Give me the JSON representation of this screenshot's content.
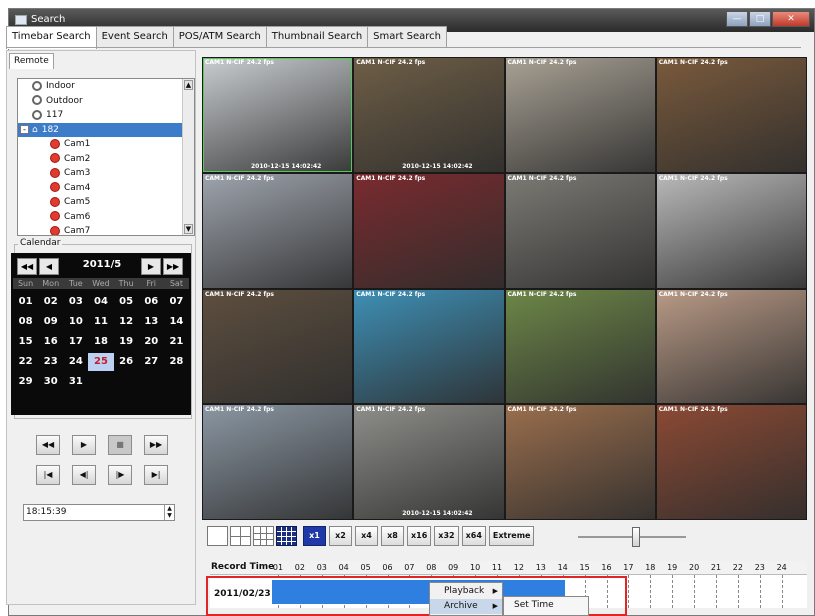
{
  "window": {
    "title": "Search",
    "btn_min": "—",
    "btn_max": "□",
    "btn_close": "✕"
  },
  "tabs": [
    "Timebar Search",
    "Event Search",
    "POS/ATM Search",
    "Thumbnail Search",
    "Smart Search"
  ],
  "remote_tab": "Remote",
  "tree": [
    {
      "label": "Indoor",
      "kind": "site"
    },
    {
      "label": "Outdoor",
      "kind": "site"
    },
    {
      "label": "117",
      "kind": "site"
    },
    {
      "label": "182",
      "kind": "home",
      "selected": true,
      "expander": "-"
    },
    {
      "label": "Cam1",
      "kind": "cam"
    },
    {
      "label": "Cam2",
      "kind": "cam"
    },
    {
      "label": "Cam3",
      "kind": "cam"
    },
    {
      "label": "Cam4",
      "kind": "cam"
    },
    {
      "label": "Cam5",
      "kind": "cam"
    },
    {
      "label": "Cam6",
      "kind": "cam"
    },
    {
      "label": "Cam7",
      "kind": "cam"
    }
  ],
  "calendar": {
    "label": "Calendar",
    "month": "2011/5",
    "weekdays": [
      "Sun",
      "Mon",
      "Tue",
      "Wed",
      "Thu",
      "Fri",
      "Sat"
    ],
    "days": [
      "01",
      "02",
      "03",
      "04",
      "05",
      "06",
      "07",
      "08",
      "09",
      "10",
      "11",
      "12",
      "13",
      "14",
      "15",
      "16",
      "17",
      "18",
      "19",
      "20",
      "21",
      "22",
      "23",
      "24",
      "25",
      "26",
      "27",
      "28",
      "29",
      "30",
      "31"
    ],
    "today": "25",
    "nav": {
      "prev_year": "◀◀",
      "prev_month": "◀",
      "next_month": "▶",
      "next_year": "▶▶"
    }
  },
  "playback_buttons": {
    "rewind": "◀◀",
    "play": "▶",
    "stop": "■",
    "fast_forward": "▶▶",
    "go_start": "|◀",
    "step_back": "◀|",
    "step_forward": "|▶",
    "go_end": "▶|"
  },
  "time_value": "18:15:39",
  "cameras": [
    {
      "label": "CAM1 N-CIF 24.2 fps",
      "timestamp": "2010-12-15  14:02:42",
      "color": "#c9cdd0"
    },
    {
      "label": "CAM1 N-CIF 24.2 fps",
      "timestamp": "2010-12-15  14:02:42",
      "color": "#6e5e46"
    },
    {
      "label": "CAM1 N-CIF 24.2 fps",
      "timestamp": "",
      "color": "#a8a194"
    },
    {
      "label": "CAM1 N-CIF 24.2 fps",
      "timestamp": "",
      "color": "#7a5a3c"
    },
    {
      "label": "CAM1 N-CIF 24.2 fps",
      "timestamp": "",
      "color": "#9ea4ad"
    },
    {
      "label": "CAM1 N-CIF 24.2 fps",
      "timestamp": "",
      "color": "#7a2b2e"
    },
    {
      "label": "CAM1 N-CIF 24.2 fps",
      "timestamp": "",
      "color": "#7c7a74"
    },
    {
      "label": "CAM1 N-CIF 24.2 fps",
      "timestamp": "",
      "color": "#b9b9b9"
    },
    {
      "label": "CAM1 N-CIF 24.2 fps",
      "timestamp": "",
      "color": "#5e4f3f"
    },
    {
      "label": "CAM1 N-CIF 24.2 fps",
      "timestamp": "",
      "color": "#3e8fb5"
    },
    {
      "label": "CAM1 N-CIF 24.2 fps",
      "timestamp": "",
      "color": "#6d8748"
    },
    {
      "label": "CAM1 N-CIF 24.2 fps",
      "timestamp": "",
      "color": "#b99a86"
    },
    {
      "label": "CAM1 N-CIF 24.2 fps",
      "timestamp": "",
      "color": "#8b97a3"
    },
    {
      "label": "CAM1 N-CIF 24.2 fps",
      "timestamp": "2010-12-15  14:02:42",
      "color": "#8e8f8a"
    },
    {
      "label": "CAM1 N-CIF 24.2 fps",
      "timestamp": "",
      "color": "#9a6e4d"
    },
    {
      "label": "CAM1 N-CIF 24.2 fps",
      "timestamp": "",
      "color": "#8c4a34"
    }
  ],
  "speed_buttons": [
    "x1",
    "x2",
    "x4",
    "x8",
    "x16",
    "x32",
    "x64",
    "Extreme"
  ],
  "timebar": {
    "label": "Record Time",
    "hours": [
      "01",
      "02",
      "03",
      "04",
      "05",
      "06",
      "07",
      "08",
      "09",
      "10",
      "11",
      "12",
      "13",
      "14",
      "15",
      "16",
      "17",
      "18",
      "19",
      "20",
      "21",
      "22",
      "23",
      "24"
    ],
    "date": "2011/02/23"
  },
  "context_menu": {
    "playback": "Playback",
    "archive": "Archive",
    "submenu_item": "Set Time"
  },
  "colors": {
    "accent": "#2f7fe0",
    "highlight_frame": "#e12424",
    "selected_node": "#3d7cc9"
  }
}
